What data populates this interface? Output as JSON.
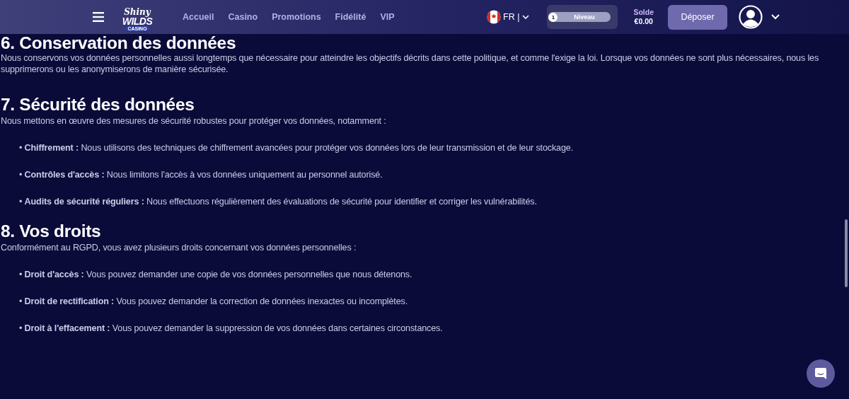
{
  "header": {
    "logo": {
      "line1": "Shiny",
      "line2": "WILDS",
      "line3": "CASINO"
    },
    "nav": [
      "Accueil",
      "Casino",
      "Promotions",
      "Fidélité",
      "VIP"
    ],
    "language": "FR |",
    "level_label": "Niveau",
    "level_number": "1",
    "balance_label": "Solde",
    "balance": "€0.00",
    "deposit_button": "Déposer"
  },
  "sections": [
    {
      "heading": "6. Conservation des données",
      "intro": "Nous conservons vos données personnelles aussi longtemps que nécessaire pour atteindre les objectifs décrits dans cette politique, et comme l'exige la loi. Lorsque vos données ne sont plus nécessaires, nous les supprimerons ou les anonymiserons de manière sécurisée."
    },
    {
      "heading": "7. Sécurité des données",
      "intro": "Nous mettons en œuvre des mesures de sécurité robustes pour protéger vos données, notamment :",
      "items": [
        "• **Chiffrement :** Nous utilisons des techniques de chiffrement avancées pour protéger vos données lors de leur transmission et de leur stockage.",
        "• **Contrôles d'accès :** Nous limitons l'accès à vos données uniquement au personnel autorisé.",
        "• **Audits de sécurité réguliers :** Nous effectuons régulièrement des évaluations de sécurité pour identifier et corriger les vulnérabilités."
      ]
    },
    {
      "heading": "8. Vos droits",
      "intro": "Conformément au RGPD, vous avez plusieurs droits concernant vos données personnelles :",
      "items": [
        "• **Droit d'accès :** Vous pouvez demander une copie de vos données personnelles que nous détenons.",
        "• **Droit de rectification :** Vous pouvez demander la correction de données inexactes ou incomplètes.",
        "• **Droit à l'effacement :** Vous pouvez demander la suppression de vos données dans certaines circonstances."
      ]
    }
  ]
}
